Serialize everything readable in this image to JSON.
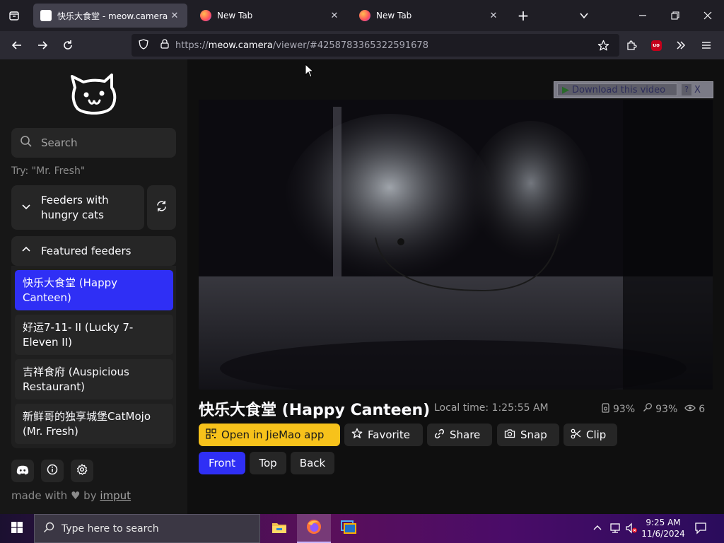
{
  "browser": {
    "tabs": [
      {
        "title": "快乐大食堂 - meow.camera",
        "active": true
      },
      {
        "title": "New Tab",
        "active": false
      },
      {
        "title": "New Tab",
        "active": false
      }
    ],
    "url": {
      "scheme": "https://",
      "host": "meow.camera",
      "path": "/viewer/#4258783365322591678"
    }
  },
  "sidebar": {
    "search_placeholder": "Search",
    "hint": "Try: \"Mr. Fresh\"",
    "hungry_section": "Feeders with hungry cats",
    "featured_section": "Featured feeders",
    "feeders": [
      {
        "name": "快乐大食堂 (Happy Canteen)",
        "active": true
      },
      {
        "name": "好运7-11- II  (Lucky 7-Eleven II)",
        "active": false
      },
      {
        "name": "吉祥食府 (Auspicious Restaurant)",
        "active": false
      },
      {
        "name": "新鲜哥的独享城堡CatMojo (Mr. Fresh)",
        "active": false
      }
    ],
    "made_with": "made with",
    "by": "by",
    "author": "imput"
  },
  "main": {
    "download_label": "Download this video",
    "download_help": "?",
    "download_close": "X",
    "camera_name": "快乐大食堂 (Happy Canteen)",
    "local_time": "Local time: 1:25:55 AM",
    "food_level": "93%",
    "battery_level": "93%",
    "viewers": "6",
    "actions": {
      "open_app": "Open in JieMao app",
      "favorite": "Favorite",
      "share": "Share",
      "snap": "Snap",
      "clip": "Clip"
    },
    "views": {
      "front": "Front",
      "top": "Top",
      "back": "Back"
    },
    "active_view": "front"
  },
  "taskbar": {
    "search_placeholder": "Type here to search",
    "time": "9:25 AM",
    "date": "11/6/2024"
  },
  "colors": {
    "accent_blue": "#2f2ff5",
    "app_yellow": "#f7c21b",
    "sidebar_bg": "#171717",
    "panel_bg": "#262626"
  }
}
